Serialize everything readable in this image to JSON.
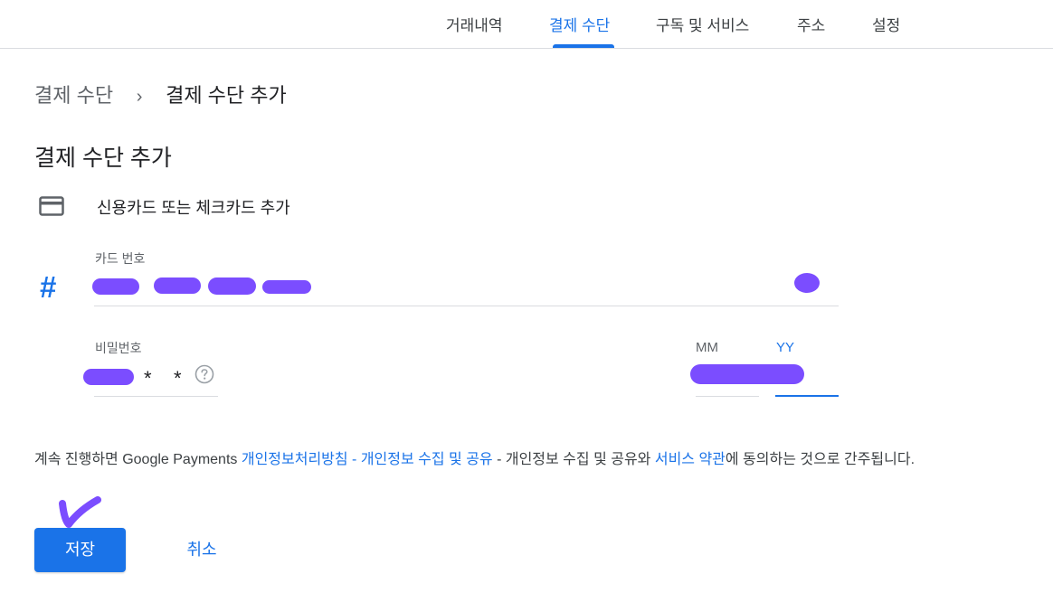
{
  "nav": {
    "tabs": [
      {
        "label": "거래내역"
      },
      {
        "label": "결제 수단",
        "active": true
      },
      {
        "label": "구독 및 서비스"
      },
      {
        "label": "주소"
      },
      {
        "label": "설정"
      }
    ]
  },
  "breadcrumb": {
    "parent": "결제 수단",
    "separator": "›",
    "current": "결제 수단 추가"
  },
  "page_title": "결제 수단 추가",
  "payment_method": {
    "icon": "credit-card-icon",
    "label": "신용카드 또는 체크카드 추가"
  },
  "form": {
    "card_number": {
      "label": "카드 번호",
      "icon": "hash-icon",
      "icon_glyph": "#"
    },
    "password": {
      "label": "비밀번호",
      "masked_chars": "*",
      "help_icon": "help-circle-icon"
    },
    "expiry": {
      "month_label": "MM",
      "year_label": "YY"
    }
  },
  "consent": {
    "prefix": "계속 진행하면 Google Payments ",
    "link1": "개인정보처리방침 - 개인정보 수집 및 공유",
    "middle": " - 개인정보 수집 및 공유와 ",
    "link2": "서비스 약관",
    "suffix": "에 동의하는 것으로 간주됩니다."
  },
  "actions": {
    "save_label": "저장",
    "cancel_label": "취소"
  },
  "colors": {
    "accent": "#1a73e8",
    "annotation": "#7b4dff"
  }
}
